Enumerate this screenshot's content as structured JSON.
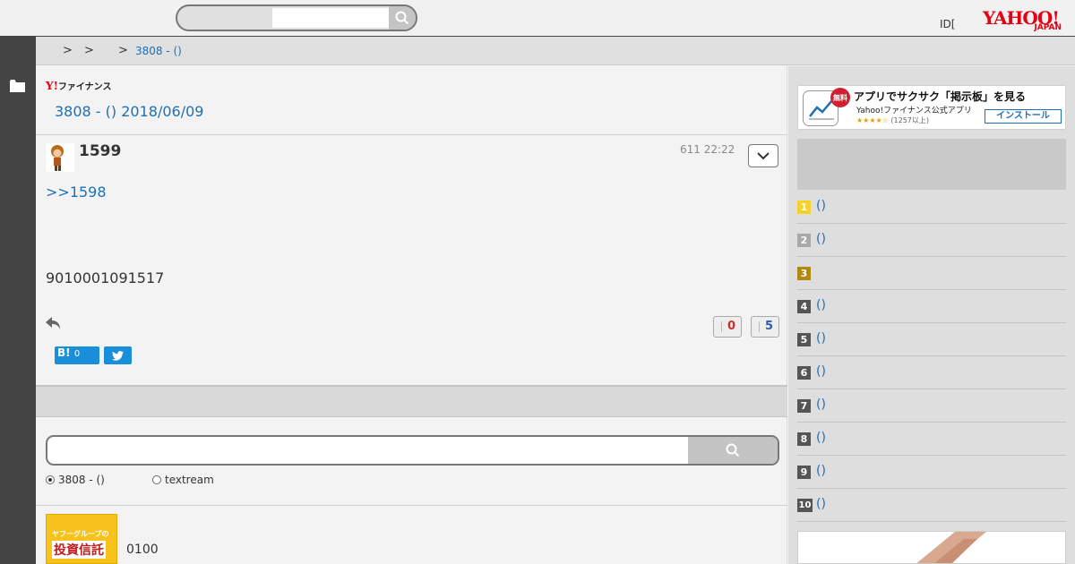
{
  "header": {
    "search_placeholder": "",
    "id_link": "ID[",
    "bracket": "]",
    "logo_text": "YAHOO!",
    "logo_sub": "JAPAN"
  },
  "breadcrumb": {
    "sep1": ">",
    "sep2": ">",
    "sep3": ">",
    "current": "3808 - ()"
  },
  "board": {
    "logo_mark": "Y!",
    "logo_text": "ファイナンス",
    "title": "3808 - () 2018/06/09"
  },
  "post": {
    "number": "1599",
    "date": "611 22:22",
    "reply_to": ">>1598",
    "body": "9010001091517",
    "down_votes": "0",
    "up_votes": "5",
    "hatena_label": "B!",
    "hatena_count": "0"
  },
  "search": {
    "placeholder": "",
    "option_board": "3808 - ()",
    "option_textream": "textream"
  },
  "promo": {
    "book_line1": "ヤフーグループの",
    "book_line2": "投資信託",
    "code": "0100"
  },
  "ad": {
    "badge": "無料",
    "headline": "アプリでサクサク「掲示板」を見る",
    "sub": "Yahoo!ファイナンス公式アプリ",
    "stars": "★★★★☆",
    "rating_count": "(1257以上)",
    "install": "インストール"
  },
  "ranking": [
    {
      "rank": "1",
      "title": "()",
      "color": "#f5d12a"
    },
    {
      "rank": "2",
      "title": "()",
      "color": "#a8a8a8"
    },
    {
      "rank": "3",
      "title": "",
      "color": "#b08a10"
    },
    {
      "rank": "4",
      "title": "()",
      "color": "#555555"
    },
    {
      "rank": "5",
      "title": "()",
      "color": "#555555"
    },
    {
      "rank": "6",
      "title": "()",
      "color": "#555555"
    },
    {
      "rank": "7",
      "title": "()",
      "color": "#555555"
    },
    {
      "rank": "8",
      "title": "()",
      "color": "#555555"
    },
    {
      "rank": "9",
      "title": "()",
      "color": "#555555"
    },
    {
      "rank": "10",
      "title": "()",
      "color": "#555555"
    }
  ],
  "icons": {
    "search": "search-icon",
    "folder": "folder-icon",
    "chevron": "chevron-down-icon",
    "reply": "reply-icon",
    "twitter": "twitter-icon"
  }
}
